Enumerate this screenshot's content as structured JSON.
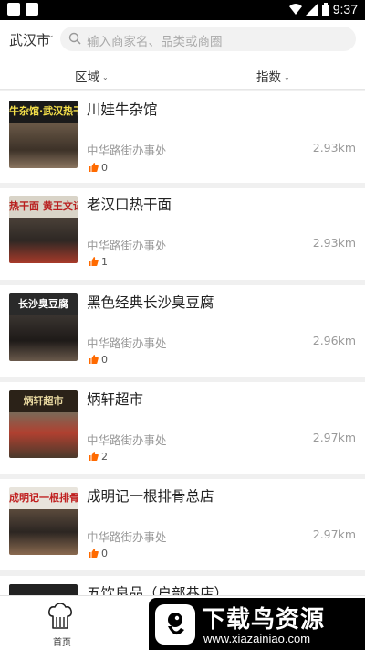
{
  "status_bar": {
    "time": "9:37"
  },
  "header": {
    "city": "武汉市",
    "search_placeholder": "输入商家名、品类或商圈"
  },
  "filters": {
    "area": "区域",
    "index": "指数"
  },
  "shops": [
    {
      "name": "川娃牛杂馆",
      "district": "中华路街办事处",
      "distance": "2.93km",
      "likes": "0",
      "sign_text": "牛杂馆·武汉热干",
      "sign_color": "#1a1a1a"
    },
    {
      "name": "老汉口热干面",
      "district": "中华路街办事处",
      "distance": "2.93km",
      "likes": "1",
      "sign_text": "热干面 黄王文记",
      "sign_color": "#d9d4c8"
    },
    {
      "name": "黑色经典长沙臭豆腐",
      "district": "中华路街办事处",
      "distance": "2.96km",
      "likes": "0",
      "sign_text": "长沙臭豆腐",
      "sign_color": "#2a2a2a"
    },
    {
      "name": "炳轩超市",
      "district": "中华路街办事处",
      "distance": "2.97km",
      "likes": "2",
      "sign_text": "炳轩超市",
      "sign_color": "#2b2218"
    },
    {
      "name": "成明记一根排骨总店",
      "district": "中华路街办事处",
      "distance": "2.97km",
      "likes": "0",
      "sign_text": "成明记一根排骨",
      "sign_color": "#e8e4dc"
    },
    {
      "name": "五饮良品（户部巷店）",
      "district": "",
      "distance": "",
      "likes": "",
      "sign_text": "",
      "sign_color": "#222222"
    }
  ],
  "bottom_nav": {
    "home_label": "首页"
  },
  "watermark": {
    "title": "下载鸟资源",
    "url": "www.xiazainiao.com"
  },
  "colors": {
    "accent": "#ff6a00",
    "status_bar": "#000000",
    "name_text": "#222222",
    "meta_text": "#999999"
  }
}
